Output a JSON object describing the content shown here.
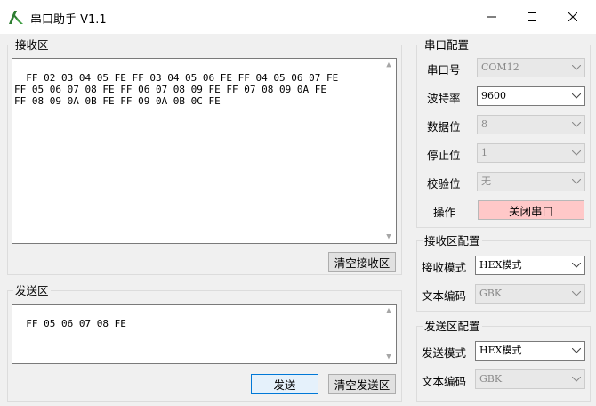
{
  "window": {
    "title": "串口助手 V1.1"
  },
  "receive": {
    "group_title": "接收区",
    "content": "FF 02 03 04 05 FE FF 03 04 05 06 FE FF 04 05 06 07 FE\nFF 05 06 07 08 FE FF 06 07 08 09 FE FF 07 08 09 0A FE\nFF 08 09 0A 0B FE FF 09 0A 0B 0C FE",
    "clear_label": "清空接收区"
  },
  "send": {
    "group_title": "发送区",
    "content": "FF 05 06 07 08 FE",
    "send_label": "发送",
    "clear_label": "清空发送区"
  },
  "serial_config": {
    "group_title": "串口配置",
    "port_label": "串口号",
    "port_value": "COM12",
    "baud_label": "波特率",
    "baud_value": "9600",
    "databits_label": "数据位",
    "databits_value": "8",
    "stopbits_label": "停止位",
    "stopbits_value": "1",
    "parity_label": "校验位",
    "parity_value": "无",
    "op_label": "操作",
    "close_port_label": "关闭串口"
  },
  "receive_config": {
    "group_title": "接收区配置",
    "mode_label": "接收模式",
    "mode_value": "HEX模式",
    "encoding_label": "文本编码",
    "encoding_value": "GBK"
  },
  "send_config": {
    "group_title": "发送区配置",
    "mode_label": "发送模式",
    "mode_value": "HEX模式",
    "encoding_label": "文本编码",
    "encoding_value": "GBK"
  },
  "colors": {
    "close_button_bg": "#ffc8c8",
    "focus_border": "#0078d7"
  }
}
